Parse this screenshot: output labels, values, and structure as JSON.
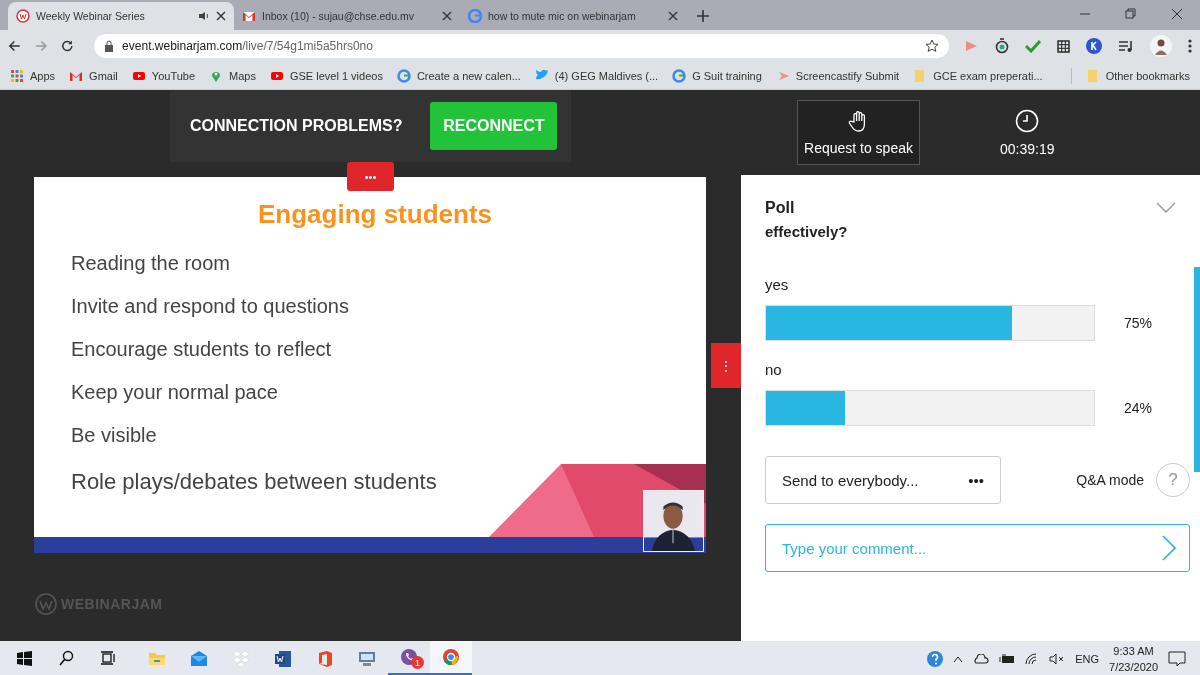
{
  "browser": {
    "tabs": [
      {
        "title": "Weekly Webinar Series",
        "selected": true,
        "audio": true
      },
      {
        "title": "Inbox (10) - sujau@chse.edu.mv",
        "selected": false,
        "audio": false
      },
      {
        "title": "how to mute mic on webinarjam",
        "selected": false,
        "audio": false
      }
    ],
    "url_host": "event.webinarjam.com",
    "url_path": "/live/7/54g1mi5a5hrs0no",
    "bookmarks": [
      "Apps",
      "Gmail",
      "YouTube",
      "Maps",
      "GSE level 1 videos",
      "Create a new calen...",
      "(4) GEG Maldives (...",
      "G Suit training",
      "Screencastify Submit",
      "GCE exam preperati..."
    ],
    "other_bookmarks": "Other bookmarks"
  },
  "webinar": {
    "connection": {
      "message": "CONNECTION PROBLEMS?",
      "button": "RECONNECT"
    },
    "slide_menu": "•••",
    "side_menu": "⋮",
    "slide": {
      "title": "Engaging students",
      "bullets": [
        "Reading the room",
        "Invite and respond to questions",
        "Encourage students to reflect",
        "Keep your normal pace",
        "Be visible",
        "Role plays/debates between students"
      ]
    },
    "logo": "WEBINARJAM",
    "request_to_speak": "Request to speak",
    "timer": "00:39:19",
    "poll": {
      "title": "Poll",
      "question": "effectively?",
      "options": [
        {
          "label": "yes",
          "level": 0.75,
          "reading": "75%"
        },
        {
          "label": "no",
          "level": 0.24,
          "reading": "24%"
        }
      ]
    },
    "send_to": {
      "value": "Send to everybody...",
      "menu": "•••"
    },
    "qa_mode": "Q&A mode",
    "help": "?",
    "comment": {
      "placeholder": "Type your comment..."
    }
  },
  "taskbar": {
    "badge": "1",
    "language": "ENG",
    "time": "9:33 AM",
    "date": "7/23/2020"
  }
}
